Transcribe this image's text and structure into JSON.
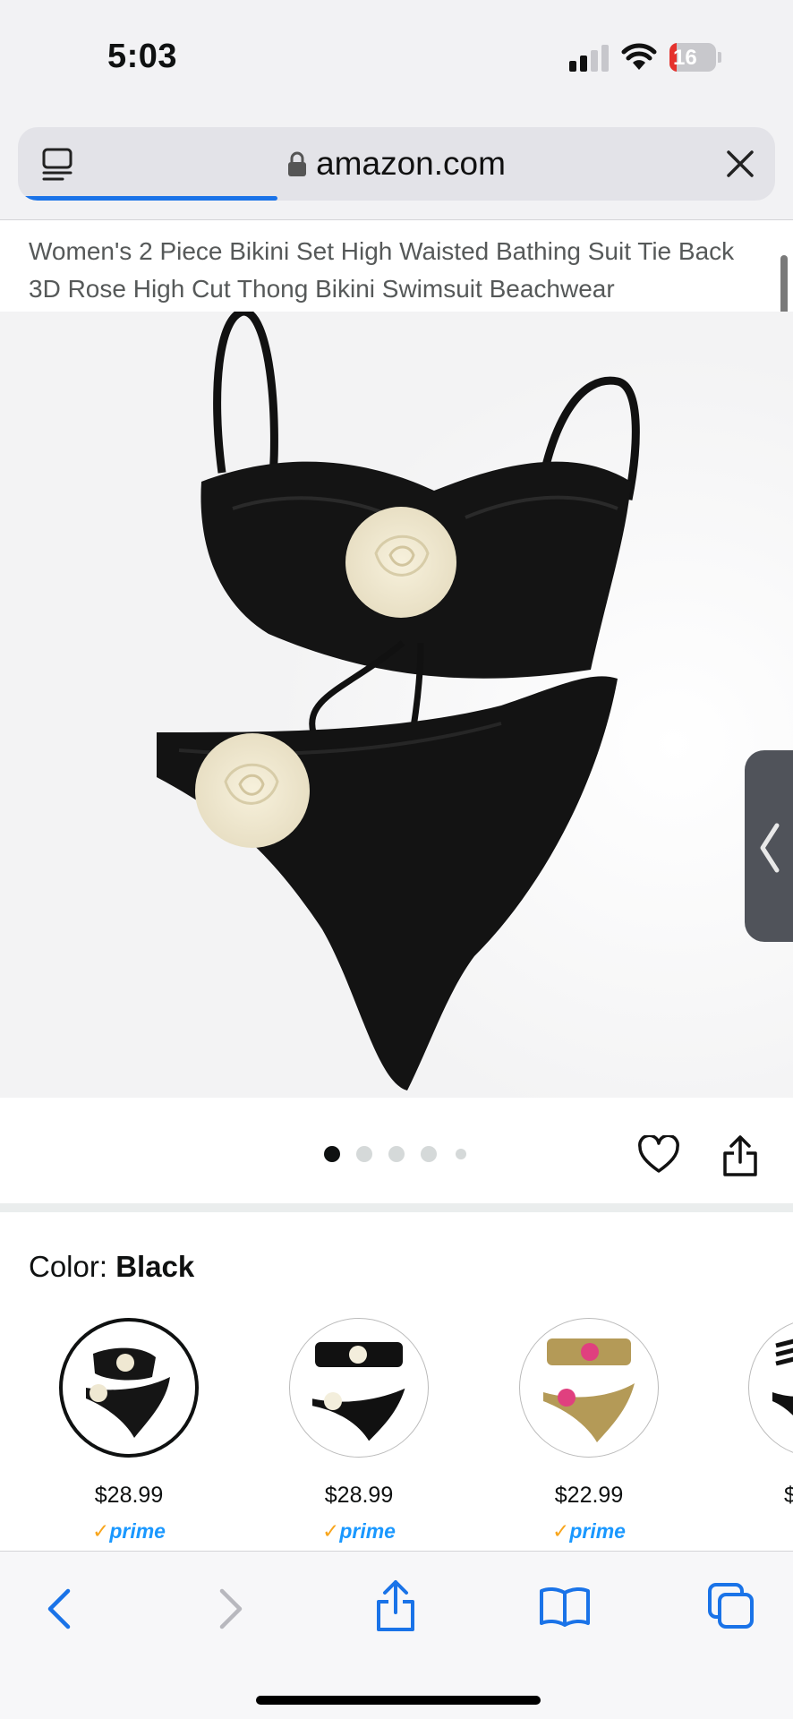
{
  "status": {
    "time": "5:03",
    "battery": "16",
    "battery_level": 0.16
  },
  "browser": {
    "url": "amazon.com",
    "load_progress": 0.34
  },
  "product": {
    "title": "Women's 2 Piece Bikini Set High Waisted Bathing Suit Tie Back 3D Rose High Cut Thong Bikini Swimsuit Beachwear",
    "image_count": 5,
    "active_image": 1
  },
  "color": {
    "label": "Color: ",
    "selected": "Black",
    "options": [
      {
        "price": "$28.99",
        "prime": "prime",
        "selected": true
      },
      {
        "price": "$28.99",
        "prime": "prime",
        "selected": false
      },
      {
        "price": "$22.99",
        "prime": "prime",
        "selected": false
      },
      {
        "price": "$",
        "prime": "",
        "selected": false
      }
    ]
  },
  "icons": {
    "tabs": "tab-overview-icon",
    "lock": "lock-icon",
    "close": "close-icon",
    "heart": "heart-icon",
    "share": "share-icon",
    "back": "back-arrow-icon",
    "forward": "forward-arrow-icon",
    "bookmarks": "bookmarks-icon",
    "tab_switch": "tabs-icon"
  },
  "colors": {
    "accent_blue": "#1a73e8",
    "prime_blue": "#1a98ff",
    "prime_check": "#f8a51c",
    "battery_red": "#e5322d"
  }
}
